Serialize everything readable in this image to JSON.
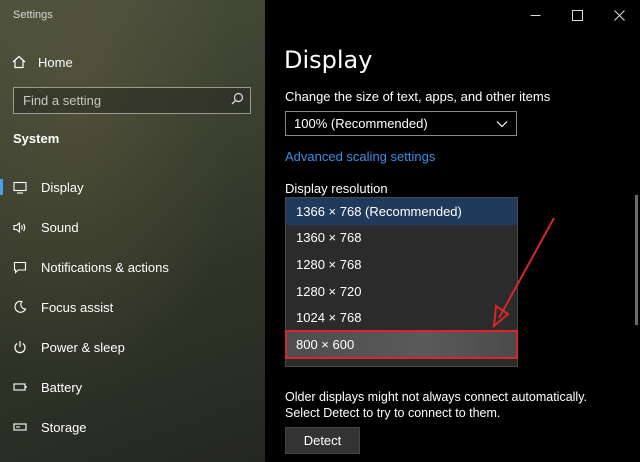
{
  "app": {
    "title": "Settings"
  },
  "sidebar": {
    "home_label": "Home",
    "search_placeholder": "Find a setting",
    "section_title": "System",
    "items": [
      {
        "label": "Display",
        "icon": "monitor-icon",
        "active": true
      },
      {
        "label": "Sound",
        "icon": "speaker-icon"
      },
      {
        "label": "Notifications & actions",
        "icon": "notification-icon"
      },
      {
        "label": "Focus assist",
        "icon": "moon-icon"
      },
      {
        "label": "Power & sleep",
        "icon": "power-icon"
      },
      {
        "label": "Battery",
        "icon": "battery-icon"
      },
      {
        "label": "Storage",
        "icon": "storage-icon"
      }
    ]
  },
  "window_controls": {
    "minimize": "—",
    "maximize": "☐",
    "close": "✕"
  },
  "main": {
    "title": "Display",
    "scale_label": "Change the size of text, apps, and other items",
    "scale_value": "100% (Recommended)",
    "advanced_link": "Advanced scaling settings",
    "resolution_label": "Display resolution",
    "resolutions": [
      "1366 × 768 (Recommended)",
      "1360 × 768",
      "1280 × 768",
      "1280 × 720",
      "1024 × 768",
      "800 × 600"
    ],
    "selected_index": 0,
    "highlighted_index": 5,
    "note_line1": "Older displays might not always connect automatically.",
    "note_line2": "Select Detect to try to connect to them.",
    "detect_label": "Detect"
  },
  "colors": {
    "accent": "#3a8ee6",
    "annotation": "#d8262b"
  }
}
